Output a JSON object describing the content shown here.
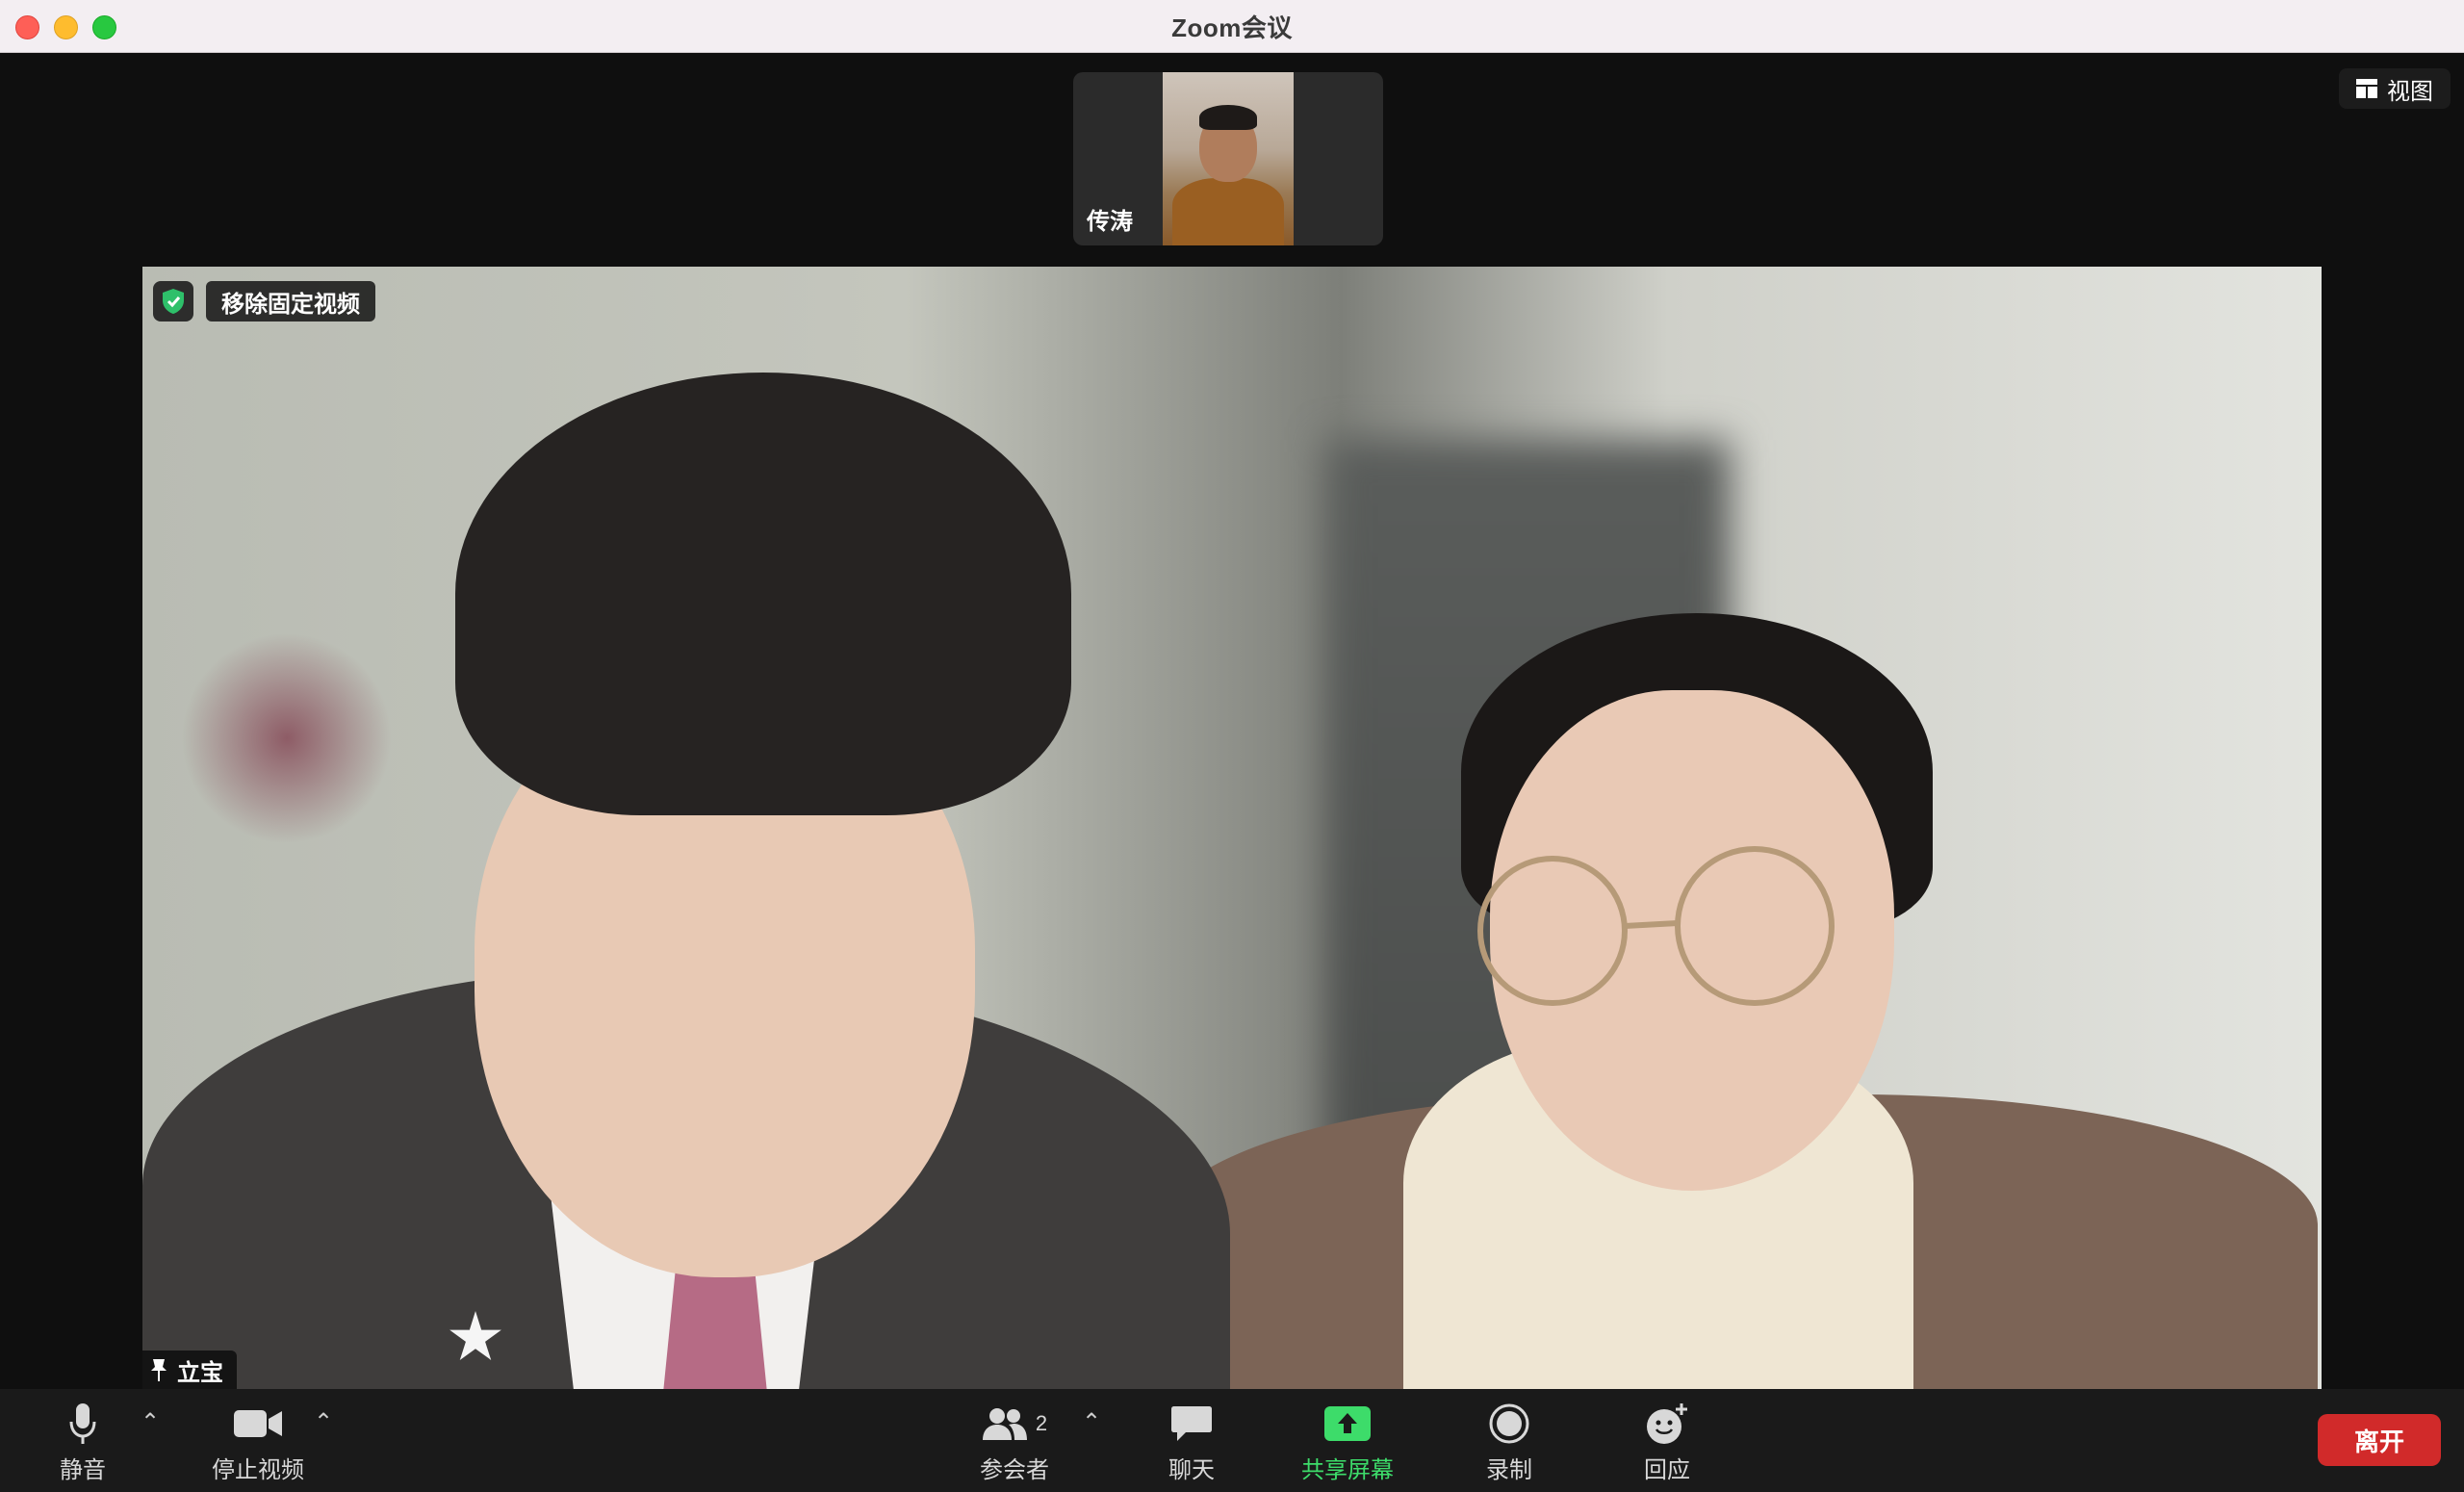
{
  "window": {
    "title": "Zoom会议"
  },
  "top_right": {
    "view_label": "视图",
    "view_icon": "grid-icon"
  },
  "thumbnail": {
    "participant_name": "传涛"
  },
  "main_video": {
    "unpin_label": "移除固定视频",
    "participant_name": "立宝",
    "secure_icon": "shield-check-icon",
    "pin_icon": "pin-icon"
  },
  "toolbar": {
    "mute_label": "静音",
    "video_label": "停止视频",
    "participants_label": "参会者",
    "participants_count": "2",
    "chat_label": "聊天",
    "share_label": "共享屏幕",
    "record_label": "录制",
    "reactions_label": "回应",
    "leave_label": "离开",
    "caret": "⌃"
  },
  "colors": {
    "share_accent": "#3ddc6a",
    "leave_button": "#d12a2a",
    "secure_green": "#2ec06a"
  }
}
